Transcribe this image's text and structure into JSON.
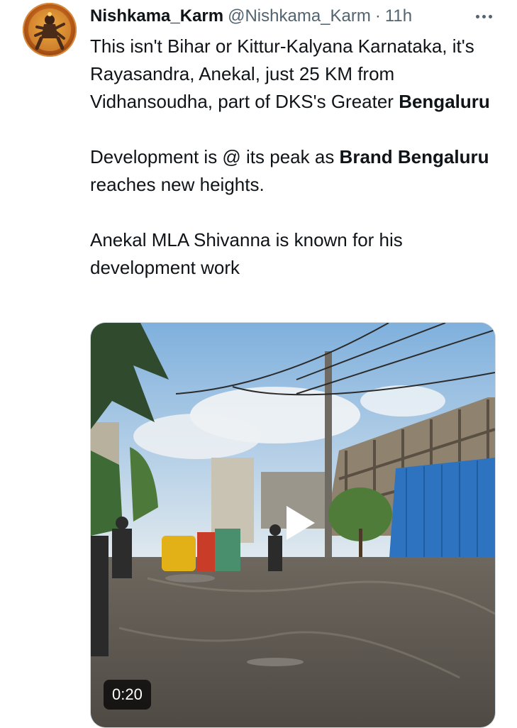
{
  "post": {
    "author_name": "Nishkama_Karm",
    "author_handle": "@Nishkama_Karm",
    "separator": "·",
    "time": "11h",
    "text": {
      "p1_part1": "This isn't Bihar or Kittur-Kalyana Karnataka, it's Rayasandra, Anekal, just 25 KM from Vidhansoudha, part of DKS's Greater ",
      "p1_bold": "Bengaluru",
      "p2_part1": "Development is @ its peak as ",
      "p2_bold": "Brand Bengaluru",
      "p2_part2": " reaches new heights.",
      "p3": "Anekal MLA Shivanna is known for his development work"
    },
    "media": {
      "duration": "0:20"
    }
  },
  "icons": {
    "more": "more-horizontal-icon",
    "play": "play-icon"
  }
}
